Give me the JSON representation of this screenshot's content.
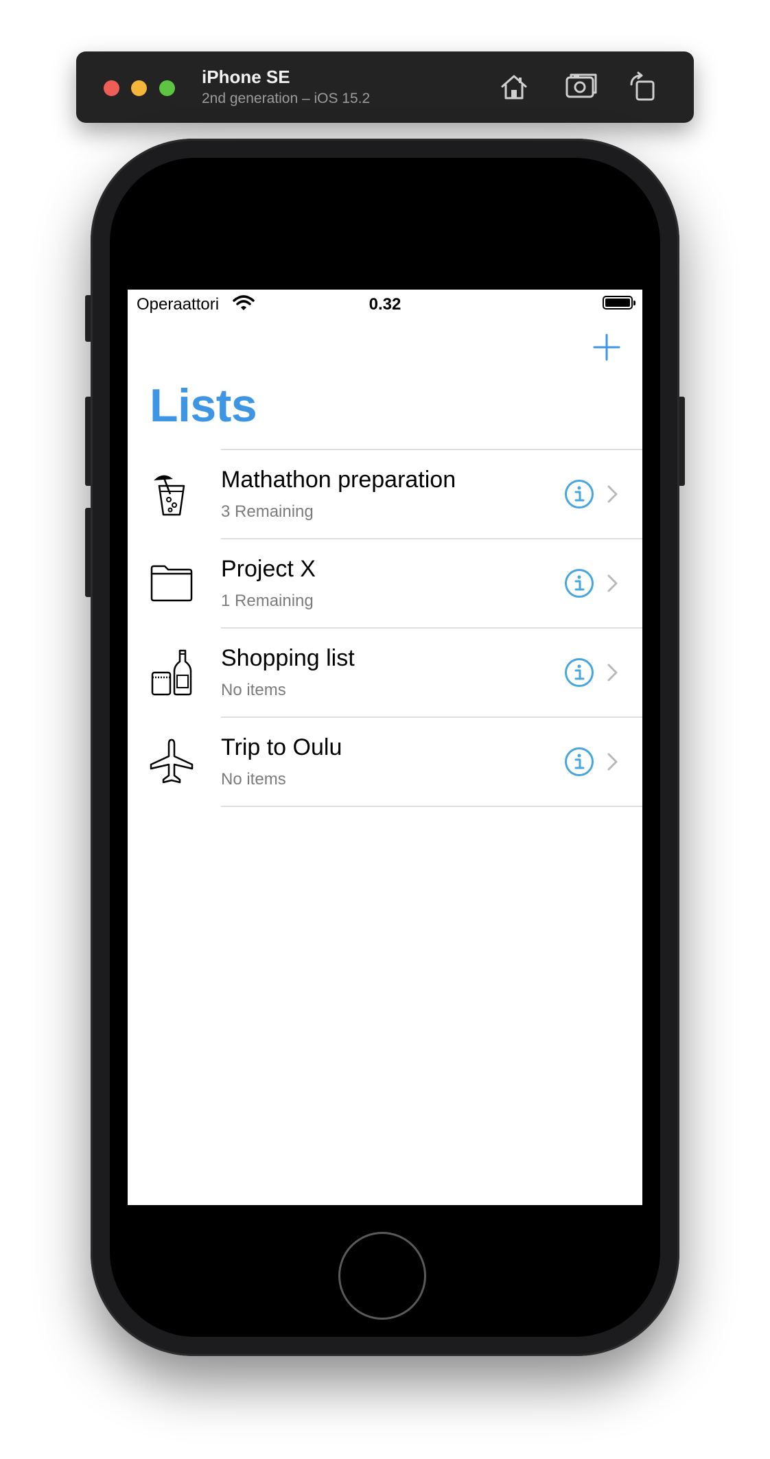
{
  "simulator": {
    "device_name": "iPhone SE",
    "device_detail": "2nd generation – iOS 15.2",
    "icons": [
      "home-icon",
      "screenshot-icon",
      "rotate-icon"
    ]
  },
  "status_bar": {
    "carrier": "Operaattori",
    "time": "0.32",
    "icons": [
      "wifi-icon",
      "battery-icon"
    ]
  },
  "navigation": {
    "title": "Lists",
    "add_icon": "plus-icon"
  },
  "colors": {
    "accent": "#3d95e3",
    "info": "#46a7e0",
    "subtitle": "#7b7b7b",
    "separator": "#dedede",
    "chevron": "#b9b9bd"
  },
  "lists": [
    {
      "title": "Mathathon preparation",
      "subtitle": "3 Remaining",
      "icon": "drink-icon"
    },
    {
      "title": "Project X",
      "subtitle": "1 Remaining",
      "icon": "folder-icon"
    },
    {
      "title": "Shopping list",
      "subtitle": "No items",
      "icon": "groceries-icon"
    },
    {
      "title": "Trip to Oulu",
      "subtitle": "No items",
      "icon": "airplane-icon"
    }
  ]
}
